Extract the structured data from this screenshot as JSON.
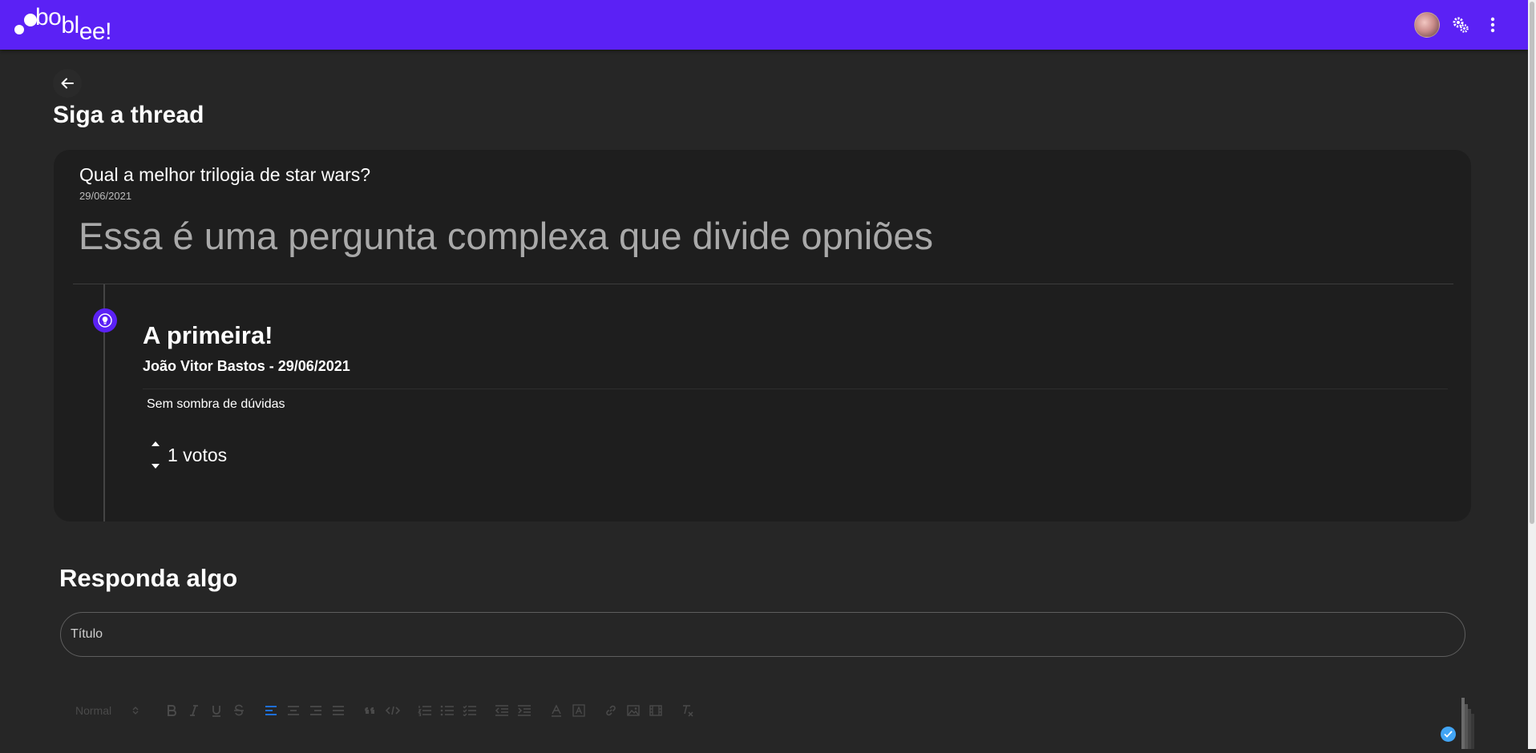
{
  "app": {
    "logo_part1": "bo",
    "logo_part2": "bl",
    "logo_part3": "ee!",
    "brand_color": "#5b21f5"
  },
  "header": {
    "avatar_icon": "user-avatar",
    "settings_icon": "gears-icon",
    "menu_icon": "more-vert-icon"
  },
  "page": {
    "back_icon": "arrow-left-icon",
    "title": "Siga a thread"
  },
  "thread": {
    "question_title": "Qual a melhor trilogia de star wars?",
    "question_date": "29/06/2021",
    "question_body": "Essa é uma pergunta complexa que divide opniões",
    "answers": [
      {
        "icon": "lightbulb-icon",
        "title": "A primeira!",
        "meta": "João Vitor Bastos - 29/06/2021",
        "body": "Sem sombra de dúvidas",
        "votes": "1 votos"
      }
    ]
  },
  "reply": {
    "heading": "Responda algo",
    "title_placeholder": "Título",
    "title_value": ""
  },
  "editor_toolbar": {
    "format_select": "Normal",
    "buttons": [
      "bold",
      "italic",
      "underline",
      "strike",
      "align-left",
      "align-center",
      "align-right",
      "align-justify",
      "blockquote",
      "code",
      "ordered-list",
      "bullet-list",
      "check-list",
      "outdent",
      "indent",
      "font-color",
      "background-color",
      "link",
      "image",
      "video",
      "clean"
    ],
    "active_color": "#1e6fd9"
  }
}
